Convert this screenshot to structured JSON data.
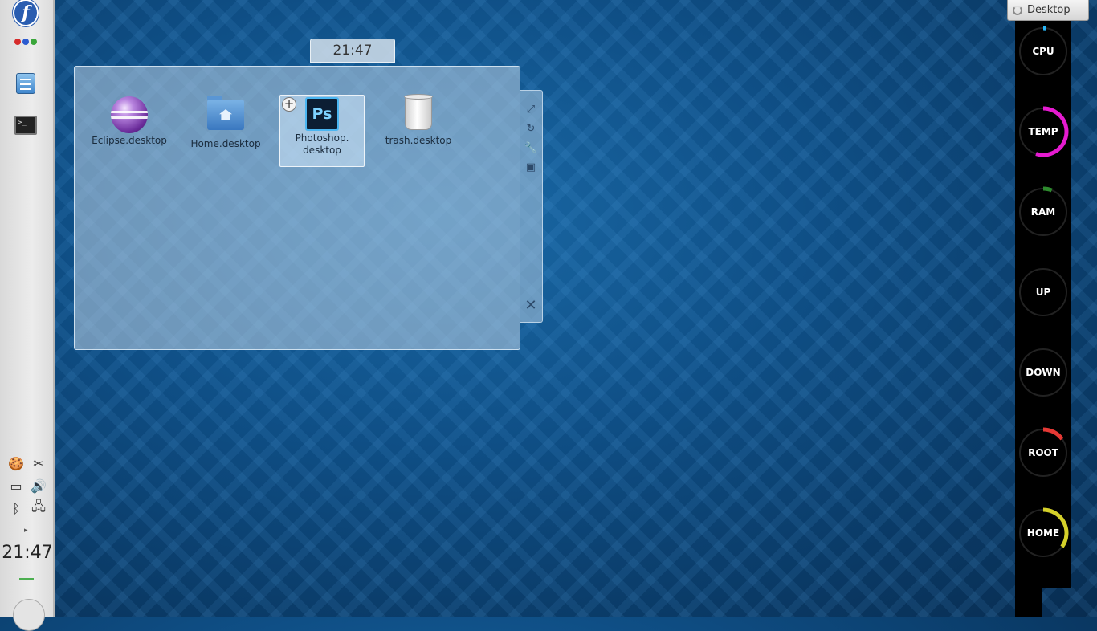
{
  "left_panel": {
    "launcher_icon": "fedora-logo-icon",
    "launcher_letter": "f",
    "dots": [
      "#d62b2b",
      "#2c5bd0",
      "#3aa63a"
    ],
    "tray_icons": [
      "pidgin-icon",
      "scissors-icon",
      "battery-icon",
      "volume-icon",
      "bluetooth-icon",
      "network-icon"
    ],
    "clock": "21:47"
  },
  "folder_view": {
    "clock": "21:47",
    "icons": [
      {
        "label": "Eclipse.desktop",
        "icon": "eclipse-icon"
      },
      {
        "label": "Home.desktop",
        "icon": "home-folder-icon"
      },
      {
        "label": "Photoshop.\ndesktop",
        "icon": "photoshop-icon",
        "selected": true,
        "badge": "+"
      },
      {
        "label": "trash.desktop",
        "icon": "trash-icon"
      }
    ],
    "ps_text": "Ps",
    "handle_buttons": [
      "resize-icon",
      "rotate-icon",
      "wrench-icon",
      "settings-icon"
    ],
    "close_glyph": "✕"
  },
  "activity_tab": {
    "label": "Desktop"
  },
  "monitor": {
    "gauges": [
      {
        "label": "CPU",
        "value": 0.02,
        "color": "#29b6f6"
      },
      {
        "label": "TEMP",
        "value": 0.55,
        "color": "#e51bd0"
      },
      {
        "label": "RAM",
        "value": 0.06,
        "color": "#2e8b2e"
      },
      {
        "label": "UP",
        "value": 0.0,
        "color": "#29b6f6"
      },
      {
        "label": "DOWN",
        "value": 0.0,
        "color": "#29b6f6"
      },
      {
        "label": "ROOT",
        "value": 0.15,
        "color": "#e53935"
      },
      {
        "label": "HOME",
        "value": 0.35,
        "color": "#d4d02a"
      }
    ]
  }
}
